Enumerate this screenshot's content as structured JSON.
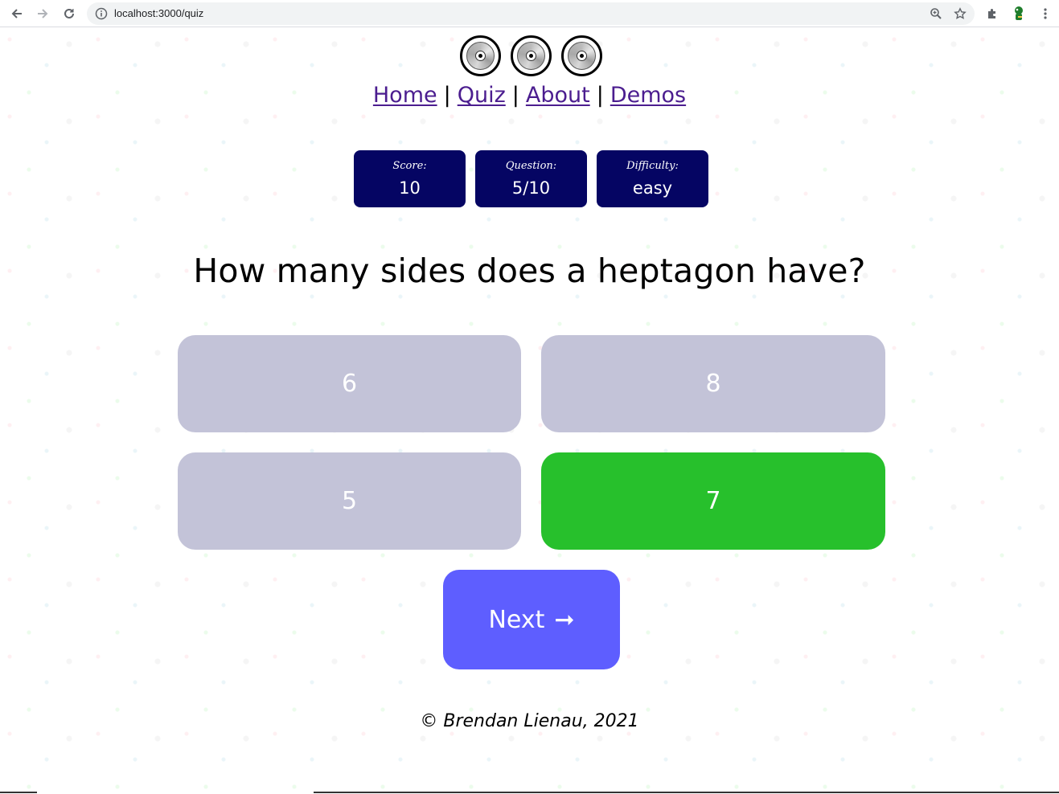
{
  "browser": {
    "url": "localhost:3000/quiz",
    "icons": [
      "back-arrow-icon",
      "forward-arrow-icon",
      "reload-icon",
      "info-icon",
      "zoom-icon",
      "star-icon",
      "puzzle-icon",
      "profile-avatar-icon",
      "menu-dots-icon"
    ]
  },
  "nav": {
    "links": [
      "Home",
      "Quiz",
      "About",
      "Demos"
    ],
    "separator": "|"
  },
  "stats": {
    "score_label": "Score:",
    "score_value": "10",
    "question_label": "Question:",
    "question_value": "5/10",
    "difficulty_label": "Difficulty:",
    "difficulty_value": "easy"
  },
  "question": {
    "text": "How many sides does a heptagon have?"
  },
  "answers": [
    "6",
    "8",
    "5",
    "7"
  ],
  "next": {
    "label": "Next",
    "arrow": "➞"
  },
  "footer": {
    "text": "© Brendan Lienau, 2021"
  },
  "colors": {
    "stat_bg": "#050563",
    "answer_default": "#c3c3d8",
    "answer_correct": "#27c02c",
    "next_button": "#5e5eff",
    "link": "#4b1d8f"
  }
}
